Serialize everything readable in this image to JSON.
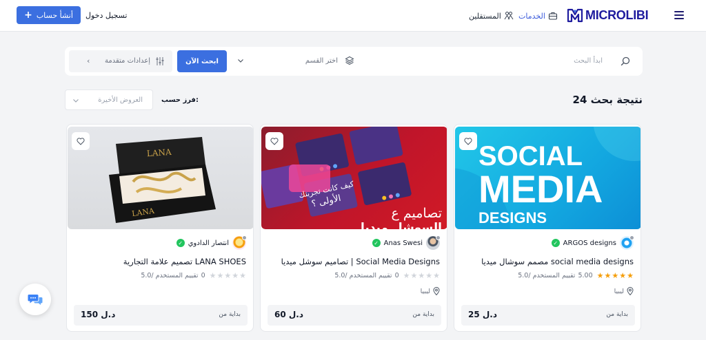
{
  "header": {
    "logo_text": "MICROLIBI",
    "nav_services": "الخدمات",
    "nav_freelancers": "المستقلين",
    "login": "تسجيل دخول",
    "create_account": "أنشأ حساب"
  },
  "search": {
    "placeholder": "ابدأ البحث",
    "category_placeholder": "اختر القسم",
    "search_button": "ابحث الآن",
    "advanced_settings": "إعدادات متقدمة"
  },
  "results": {
    "title": "24 نتيجة بحث",
    "sort_label": "فرز حسب:",
    "sort_value": "العروض الأخيرة"
  },
  "cards": [
    {
      "seller": "ARGOS designs",
      "title": "مصمم سوشال ميديا social media designs",
      "rating_value": "5.00",
      "rating_text": "5.0/ تقييم المستخدم",
      "stars": 5,
      "location": "ليبيا",
      "from": "بداية من",
      "price": "25 د.ل",
      "image_text": [
        "SOCIAL",
        "MEDIA",
        "DESIGNS"
      ]
    },
    {
      "seller": "Anas Swesi",
      "title": "تصاميم سوشل ميديا | Social Media Designs",
      "rating_value": "0",
      "rating_text": "5.0/ تقييم المستخدم",
      "stars": 0,
      "location": "ليبيا",
      "from": "بداية من",
      "price": "60 د.ل",
      "image_text": [
        "تصاميم ع",
        "السوشل ميديا",
        "كيف كانت تجربتك",
        "الأولى ؟"
      ]
    },
    {
      "seller": "انتصار الدادوي",
      "title": "تصميم علامة التجارية LANA SHOES",
      "rating_value": "0",
      "rating_text": "5.0/ تقييم المستخدم",
      "stars": 0,
      "from": "بداية من",
      "price": "150 د.ل",
      "image_text": [
        "LANA"
      ]
    }
  ],
  "colors": {
    "primary": "#3b6fe0",
    "brand": "#1e1b9e",
    "star": "#f59e0b",
    "verified": "#22c55e"
  }
}
